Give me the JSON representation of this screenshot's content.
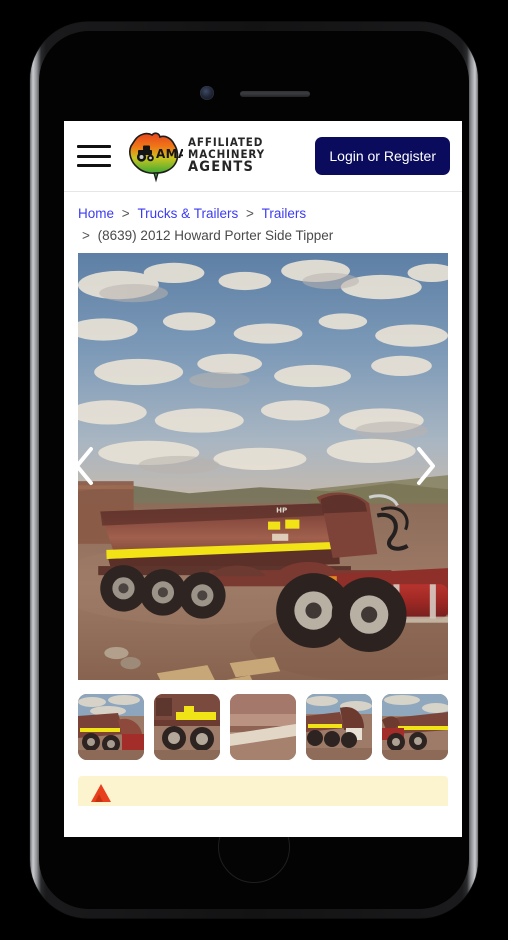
{
  "device": {
    "type": "smartphone-mockup",
    "hardware": {
      "earpiece_speaker": "speaker-grille",
      "front_camera": "front-camera",
      "home_button": "home-button"
    }
  },
  "header": {
    "menu_icon": "hamburger-menu-icon",
    "logo": {
      "icon": "australia-map-tractor-logo",
      "monogram": "AMA",
      "gradient_from": "#e8441f",
      "gradient_to": "#3faa33"
    },
    "brand": {
      "line1": "AFFILIATED",
      "line2": "MACHINERY",
      "line3": "AGENTS"
    },
    "login_button": {
      "label": "Login or Register",
      "background": "#0b0b5e",
      "text_color": "#ffffff"
    }
  },
  "breadcrumb": {
    "separator": ">",
    "link_color": "#3c3cf0",
    "items": [
      {
        "label": "Home",
        "is_link": true
      },
      {
        "label": "Trucks & Trailers",
        "is_link": true
      },
      {
        "label": "Trailers",
        "is_link": true
      }
    ],
    "current": "(8639) 2012 Howard Porter Side Tipper"
  },
  "gallery": {
    "main_image": {
      "alt": "Red Howard Porter side tipper trailer coupled to a prime mover on red dirt under a cloudy sky",
      "subject": "side-tipper-trailer"
    },
    "prev_arrow_icon": "chevron-left-icon",
    "next_arrow_icon": "chevron-right-icon",
    "thumbnails": [
      {
        "alt": "Side tipper trailer side view with prime mover",
        "selected": false
      },
      {
        "alt": "Trailer yellow stripe and wheels close up",
        "selected": false
      },
      {
        "alt": "Tipper body underside and ground",
        "selected": false
      },
      {
        "alt": "Trailer rear three-quarter view tipped",
        "selected": false
      },
      {
        "alt": "Trailer front three-quarter view",
        "selected": false
      }
    ]
  },
  "notice_banner": {
    "icon": "warning-icon",
    "background": "#fcf3cf"
  }
}
